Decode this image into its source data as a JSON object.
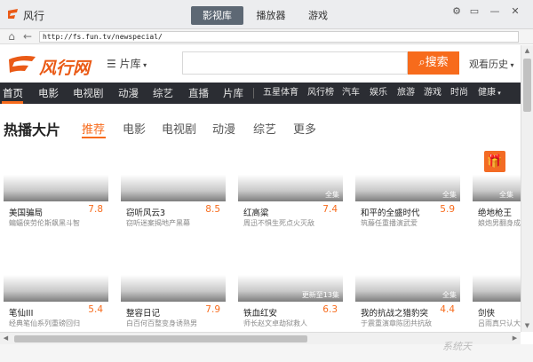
{
  "app": {
    "name": "风行"
  },
  "top_tabs": [
    {
      "label": "影视库",
      "active": true
    },
    {
      "label": "播放器",
      "active": false
    },
    {
      "label": "游戏",
      "active": false
    }
  ],
  "window_controls": {
    "settings": "⚙",
    "restore": "▭",
    "minimize": "—",
    "close": "✕"
  },
  "address": {
    "url": "http://fs.fun.tv/newspecial/",
    "back": "←",
    "home": "⌂"
  },
  "header": {
    "brand": "风行网",
    "library_menu": "片库",
    "search_button": "搜索",
    "history": "观看历史"
  },
  "nav": {
    "primary": [
      "首页",
      "电影",
      "电视剧",
      "动漫",
      "综艺",
      "直播",
      "片库"
    ],
    "secondary": [
      "五星体育",
      "风行榜",
      "汽车",
      "娱乐",
      "旅游",
      "游戏",
      "时尚",
      "健康"
    ]
  },
  "section": {
    "title": "热播大片",
    "tabs": [
      "推荐",
      "电影",
      "电视剧",
      "动漫",
      "综艺",
      "更多"
    ]
  },
  "row1": [
    {
      "title": "美国骗局",
      "score": "7.8",
      "desc": "蝙蝠侠劳伦斯飙黑斗智",
      "badge": ""
    },
    {
      "title": "窃听风云3",
      "score": "8.5",
      "desc": "窃听迷案揭地产黑幕",
      "badge": ""
    },
    {
      "title": "红高粱",
      "score": "7.4",
      "desc": "周迅不惧生死点火灭敌",
      "badge": "全集"
    },
    {
      "title": "和平的全盛时代",
      "score": "5.9",
      "desc": "筑藤任重播演武爱",
      "badge": "全集"
    },
    {
      "title": "绝地枪王",
      "score": "",
      "desc": "娘炮男翻身成",
      "badge": "全集"
    }
  ],
  "row2": [
    {
      "title": "笔仙III",
      "score": "5.4",
      "desc": "经典笔仙系列重磅回归",
      "badge": ""
    },
    {
      "title": "整容日记",
      "score": "7.9",
      "desc": "白百何百整变身诱熟男",
      "badge": ""
    },
    {
      "title": "铁血红安",
      "score": "6.3",
      "desc": "师长赵文卓劫狱救人",
      "badge": "更新至13集"
    },
    {
      "title": "我的抗战之猎豹突",
      "score": "4.4",
      "desc": "于震重演章陈团共抗敌",
      "badge": "全集"
    },
    {
      "title": "剑侠",
      "score": "",
      "desc": "吕雨真只认大",
      "badge": ""
    }
  ],
  "watermark": "系统天"
}
